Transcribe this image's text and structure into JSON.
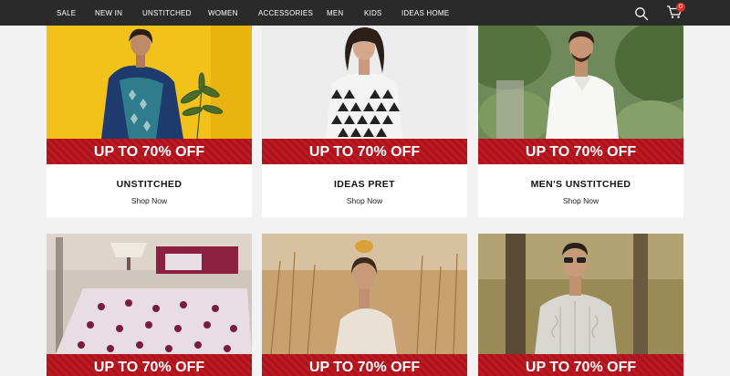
{
  "nav": {
    "items": [
      "SALE",
      "NEW IN",
      "UNSTITCHED",
      "WOMEN",
      "ACCESSORIES",
      "MEN",
      "KIDS",
      "IDEAS HOME"
    ],
    "search_icon": "search-icon",
    "cart_icon": "cart-icon",
    "cart_count": "0"
  },
  "colors": {
    "topbar": "#2a2a2a",
    "banner": "#b5121b",
    "page_bg": "#f2f2f2",
    "badge": "#e0312b"
  },
  "cards": [
    {
      "banner": "UP TO 70% OFF",
      "title": "UNSTITCHED",
      "link": "Shop Now"
    },
    {
      "banner": "UP TO 70% OFF",
      "title": "IDEAS PRET",
      "link": "Shop Now"
    },
    {
      "banner": "UP TO 70% OFF",
      "title": "MEN'S UNSTITCHED",
      "link": "Shop Now"
    },
    {
      "banner": "UP TO 70% OFF"
    },
    {
      "banner": "UP TO 70% OFF"
    },
    {
      "banner": "UP TO 70% OFF"
    }
  ]
}
